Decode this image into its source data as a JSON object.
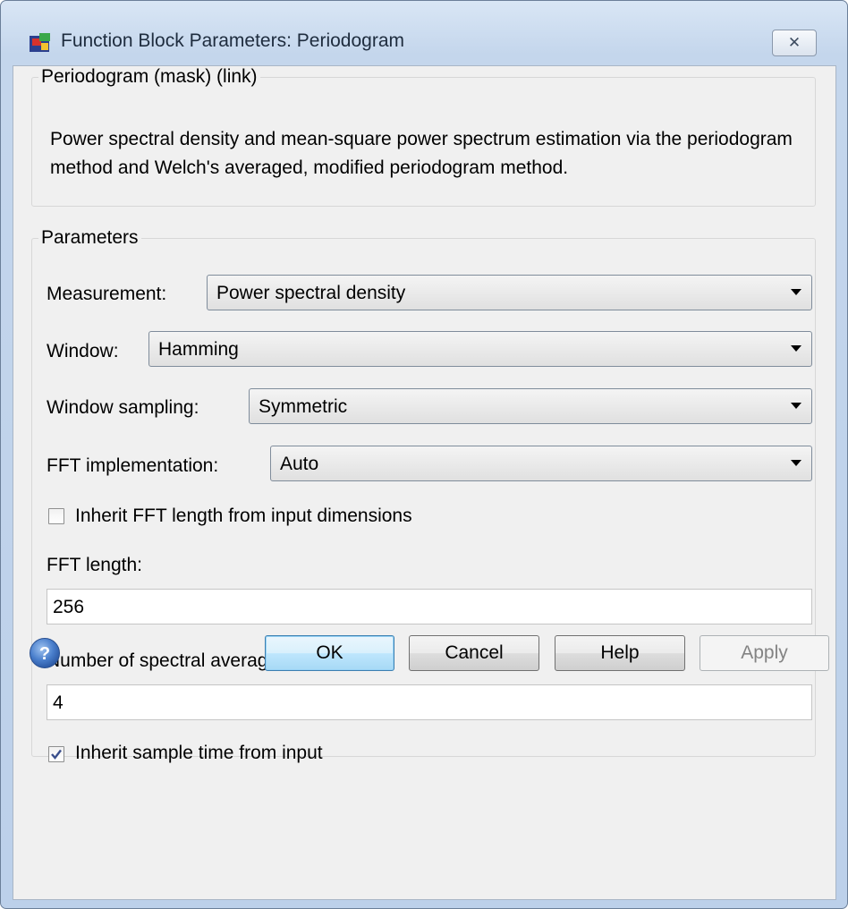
{
  "window": {
    "title": "Function Block Parameters: Periodogram",
    "close_label": "✕"
  },
  "mask_group": {
    "legend": "Periodogram (mask) (link)",
    "description": "Power spectral density and mean-square power spectrum estimation via the periodogram method and Welch's averaged, modified periodogram method."
  },
  "params_group": {
    "legend": "Parameters",
    "measurement": {
      "label": "Measurement:",
      "value": "Power spectral density"
    },
    "window": {
      "label": "Window:",
      "value": "Hamming"
    },
    "window_sampling": {
      "label": "Window sampling:",
      "value": "Symmetric"
    },
    "fft_impl": {
      "label": "FFT implementation:",
      "value": "Auto"
    },
    "inherit_fft": {
      "label": "Inherit FFT length from input dimensions",
      "checked": false
    },
    "fft_length": {
      "label": "FFT length:",
      "value": "256"
    },
    "spectral_avg": {
      "label": "Number of spectral averages:",
      "value": "4"
    },
    "inherit_sample_time": {
      "label": "Inherit sample time from input",
      "checked": true
    }
  },
  "buttons": {
    "ok": "OK",
    "cancel": "Cancel",
    "help": "Help",
    "apply": "Apply"
  },
  "icons": {
    "app": "simulink-block-icon",
    "help": "help-question-icon"
  },
  "colors": {
    "titlebar": "#c4d6ec",
    "client": "#f0f0f0",
    "default_button_border": "#3c7fb1",
    "help_icon": "#3a69b5"
  }
}
